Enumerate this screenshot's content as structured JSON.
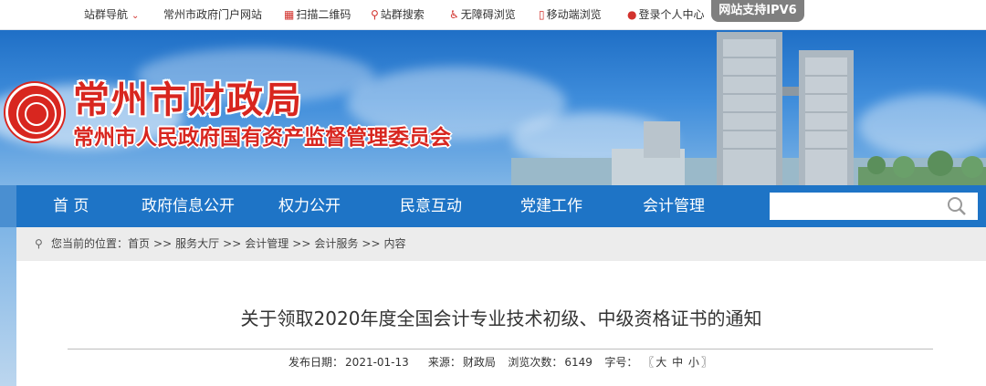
{
  "topbar": {
    "site_nav": "站群导航",
    "gov_portal": "常州市政府门户网站",
    "qr_code": "扫描二维码",
    "site_search": "站群搜索",
    "accessible": "无障碍浏览",
    "mobile": "移动端浏览",
    "login": "登录个人中心",
    "ipv6": "网站支持IPV6"
  },
  "banner": {
    "title": "常州市财政局",
    "subtitle": "常州市人民政府国有资产监督管理委员会"
  },
  "nav": {
    "items": [
      "首 页",
      "政府信息公开",
      "权力公开",
      "民意互动",
      "党建工作",
      "会计管理"
    ]
  },
  "search": {
    "placeholder": ""
  },
  "breadcrumb": {
    "prefix": "您当前的位置：",
    "items": [
      "首页",
      "服务大厅",
      "会计管理",
      "会计服务",
      "内容"
    ],
    "separator": ">>"
  },
  "article": {
    "title": "关于领取2020年度全国会计专业技术初级、中级资格证书的通知",
    "date_label": "发布日期：",
    "date": "2021-01-13",
    "source_label": "来源：",
    "source": "财政局",
    "views_label": "浏览次数：",
    "views": "6149",
    "font_label": "字号：",
    "font_open": "〖",
    "font_large": "大",
    "font_medium": "中",
    "font_small": "小",
    "font_close": "〗"
  },
  "colors": {
    "accent_red": "#d8261f",
    "nav_blue": "#1e74c6",
    "ipv6_gray": "#7f7f7f"
  }
}
